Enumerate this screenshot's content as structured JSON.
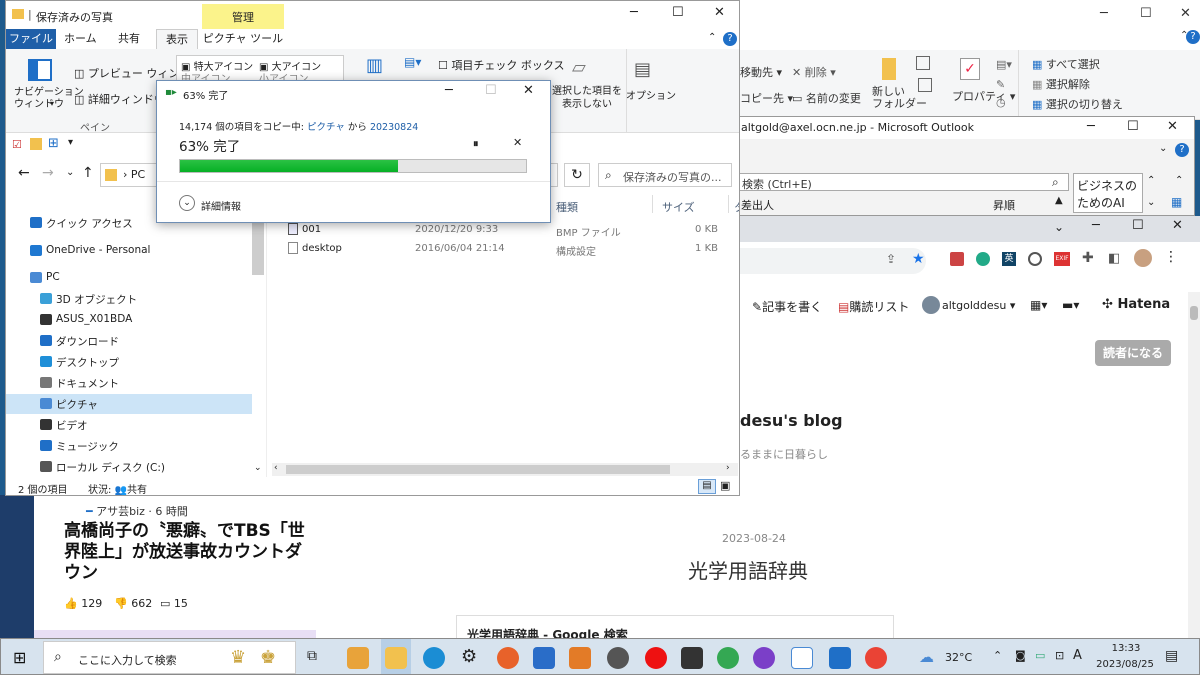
{
  "explorer": {
    "title": "保存済みの写真",
    "manage_tab": "管理",
    "tabs": [
      "ファイル",
      "ホーム",
      "共有",
      "表示",
      "ピクチャ ツール"
    ],
    "ribbon": {
      "nav_pane": "ナビゲーション\nウィンドウ",
      "preview": "プレビュー ウィンドウ",
      "details": "詳細ウィンドウ",
      "pane_group": "ペイン",
      "xl_icons": "特大アイコン",
      "l_icons": "大アイコン",
      "m_icons": "中アイコン",
      "s_icons": "小アイコン",
      "checkbox": "項目チェック ボックス",
      "hide_selected": "選択した項目を\n表示しない",
      "options": "オプション"
    },
    "address": "PC",
    "search_placeholder": "保存済みの写真の...",
    "columns": [
      "種類",
      "サイズ",
      "タ"
    ],
    "files": [
      {
        "name": "001",
        "date": "2020/12/20 9:33",
        "type": "BMP ファイル",
        "size": "0 KB"
      },
      {
        "name": "desktop",
        "date": "2016/06/04 21:14",
        "type": "構成設定",
        "size": "1 KB"
      }
    ],
    "nav": [
      {
        "label": "クイック アクセス",
        "icon": "star-icon",
        "color": "#1f6fc7"
      },
      {
        "label": "OneDrive - Personal",
        "icon": "cloud-icon",
        "color": "#1f78d1"
      },
      {
        "label": "PC",
        "icon": "pc-icon",
        "color": "#4a8ad4"
      },
      {
        "label": "3D オブジェクト",
        "icon": "cube-icon",
        "color": "#3aa0d8"
      },
      {
        "label": "ASUS_X01BDA",
        "icon": "phone-icon",
        "color": "#333333"
      },
      {
        "label": "ダウンロード",
        "icon": "download-icon",
        "color": "#1f6fc7"
      },
      {
        "label": "デスクトップ",
        "icon": "desktop-icon",
        "color": "#1f8fd8"
      },
      {
        "label": "ドキュメント",
        "icon": "document-icon",
        "color": "#777777"
      },
      {
        "label": "ピクチャ",
        "icon": "picture-icon",
        "color": "#4a8ad4"
      },
      {
        "label": "ビデオ",
        "icon": "video-icon",
        "color": "#333333"
      },
      {
        "label": "ミュージック",
        "icon": "music-icon",
        "color": "#1f6fc7"
      },
      {
        "label": "ローカル ディスク (C:)",
        "icon": "disk-icon",
        "color": "#555555"
      }
    ],
    "status_count": "2 個の項目",
    "status_share": "状況: ",
    "status_share_value": "共有"
  },
  "dialog": {
    "title": "63% 完了",
    "copy_prefix": "14,174 個の項目をコピー中: ",
    "copy_src": "ピクチャ",
    "copy_mid": " から ",
    "copy_dst": "20230824",
    "percent_text": "63% 完了",
    "progress": 0.63,
    "details": "詳細情報"
  },
  "ribbon_bg": {
    "move": "移動先",
    "delete": "削除",
    "copy": "コピー先",
    "rename": "名前の変更",
    "new_folder": "新しい\nフォルダー",
    "properties": "プロパティ",
    "select_all": "すべて選択",
    "select_none": "選択解除",
    "invert": "選択の切り替え"
  },
  "outlook": {
    "title": "altgold@axel.ocn.ne.jp - Microsoft Outlook",
    "search": "検索 (Ctrl+E)",
    "from": "差出人",
    "sort": "昇順",
    "ad": "ビジネスの\nためのAI"
  },
  "chrome": {
    "write": "記事を書く",
    "reader_list": "購読リスト",
    "user": "altgolddesu",
    "brand": "Hatena",
    "subscribe": "読者になる",
    "blog_title": "desu's blog",
    "blog_sub": "るままに日暮らし",
    "post_date": "2023-08-24",
    "post_title": "光学用語辞典",
    "embed": "光学用語辞典 - Google 検索"
  },
  "news": {
    "source": "アサ芸biz · 6 時間",
    "headline": "高橋尚子の〝悪癖〟でTBS「世界陸上」が放送事故カウントダウン",
    "likes": "129",
    "dislikes": "662",
    "comments": "15"
  },
  "taskbar": {
    "search": "ここに入力して検索",
    "temp": "32°C",
    "ime": "A",
    "time": "13:33",
    "date": "2023/08/25"
  },
  "colors": {
    "accent": "#1f5fa8",
    "progress": "#06b025",
    "ribbon_file": "#1f5fa8",
    "manage": "#fbf38b"
  }
}
